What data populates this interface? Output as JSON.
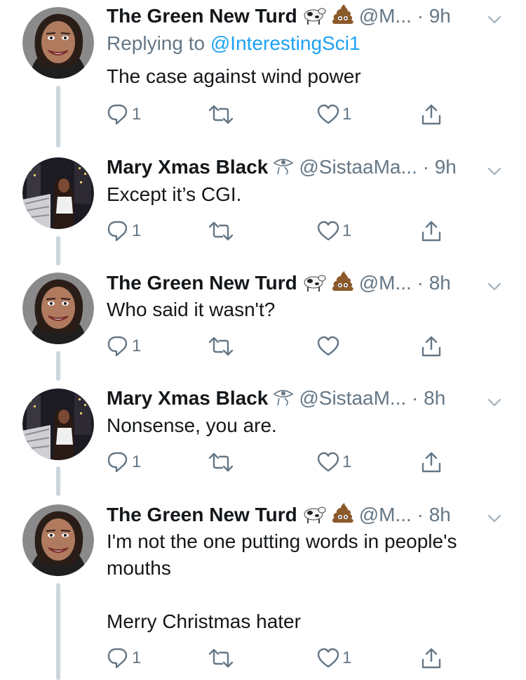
{
  "tweets": [
    {
      "name": "The Green New Turd",
      "name_emojis": [
        "cow-emoji",
        "poop-emoji"
      ],
      "handle": "@M...",
      "time": "· 9h",
      "reply_prefix": "Replying to ",
      "reply_target": "@InterestingSci1",
      "text": "The case against wind power",
      "replies": "1",
      "retweets": "",
      "likes": "1",
      "avatar": "woman-face-avatar"
    },
    {
      "name": "Mary Xmas Black",
      "name_emojis": [
        "eye-of-horus-emoji"
      ],
      "handle": "@SistaaMa...",
      "time": "· 9h",
      "text": "Except it’s CGI.",
      "replies": "1",
      "retweets": "",
      "likes": "1",
      "avatar": "city-night-photo-avatar"
    },
    {
      "name": "The Green New Turd",
      "name_emojis": [
        "cow-emoji",
        "poop-emoji"
      ],
      "handle": "@M...",
      "time": "· 8h",
      "text": "Who said it wasn't?",
      "replies": "1",
      "retweets": "",
      "likes": "",
      "avatar": "woman-face-avatar"
    },
    {
      "name": "Mary Xmas Black",
      "name_emojis": [
        "eye-of-horus-emoji"
      ],
      "handle": "@SistaaM...",
      "time": "· 8h",
      "text": "Nonsense, you are.",
      "replies": "1",
      "retweets": "",
      "likes": "1",
      "avatar": "city-night-photo-avatar"
    },
    {
      "name": "The Green New Turd",
      "name_emojis": [
        "cow-emoji",
        "poop-emoji"
      ],
      "handle": "@M...",
      "time": "· 8h",
      "text": "I'm not the one putting words in people's\nmouths\n\nMerry Christmas hater",
      "replies": "1",
      "retweets": "",
      "likes": "1",
      "avatar": "woman-face-avatar"
    }
  ],
  "colors": {
    "text": "#14171a",
    "muted": "#657786",
    "link": "#1da1f2",
    "thread_line": "#ccd6dd"
  }
}
